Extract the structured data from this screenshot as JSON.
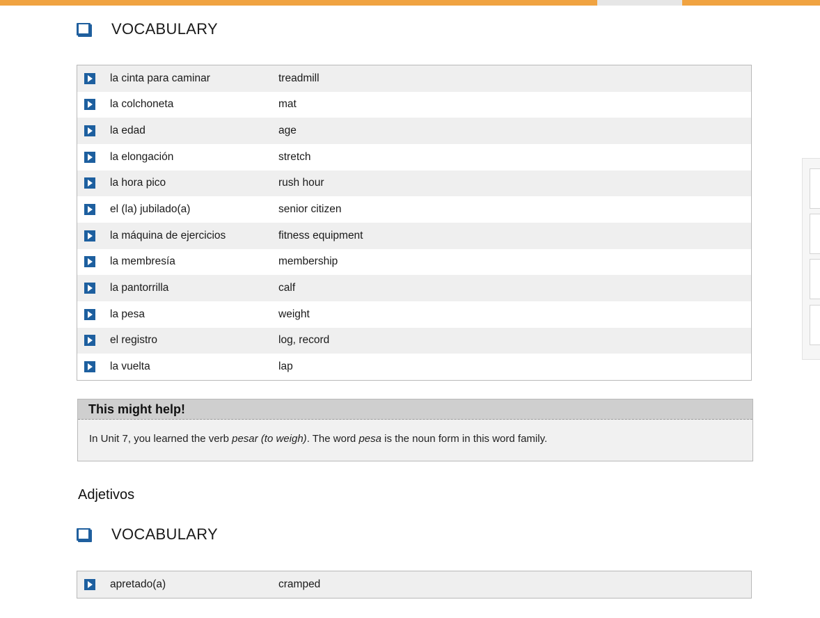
{
  "vocab_header_1": {
    "title": "VOCABULARY",
    "icon": "book-icon"
  },
  "vocab_table_1": [
    {
      "term": "la cinta para caminar",
      "meaning": "treadmill"
    },
    {
      "term": "la colchoneta",
      "meaning": "mat"
    },
    {
      "term": "la edad",
      "meaning": "age"
    },
    {
      "term": "la elongación",
      "meaning": "stretch"
    },
    {
      "term": "la hora pico",
      "meaning": "rush hour"
    },
    {
      "term": "el (la) jubilado(a)",
      "meaning": "senior citizen"
    },
    {
      "term": "la máquina de ejercicios",
      "meaning": "fitness equipment"
    },
    {
      "term": "la membresía",
      "meaning": "membership"
    },
    {
      "term": "la pantorrilla",
      "meaning": "calf"
    },
    {
      "term": "la pesa",
      "meaning": "weight"
    },
    {
      "term": "el registro",
      "meaning": "log, record"
    },
    {
      "term": "la vuelta",
      "meaning": "lap"
    }
  ],
  "help_box": {
    "title": "This might help!",
    "text_part1": "In Unit 7, you learned the verb ",
    "text_italic1": "pesar (to weigh)",
    "text_part2": ". The word ",
    "text_italic2": "pesa",
    "text_part3": " is the noun form in this word family."
  },
  "section_heading": "Adjetivos",
  "vocab_header_2": {
    "title": "VOCABULARY",
    "icon": "book-icon"
  },
  "vocab_table_2": [
    {
      "term": "apretado(a)",
      "meaning": "cramped"
    }
  ],
  "colors": {
    "accent_bar": "#f0a341",
    "play_button": "#1d5f9f",
    "row_stripe": "#efefef"
  },
  "icons": {
    "play": "play-icon",
    "book": "book-icon"
  }
}
